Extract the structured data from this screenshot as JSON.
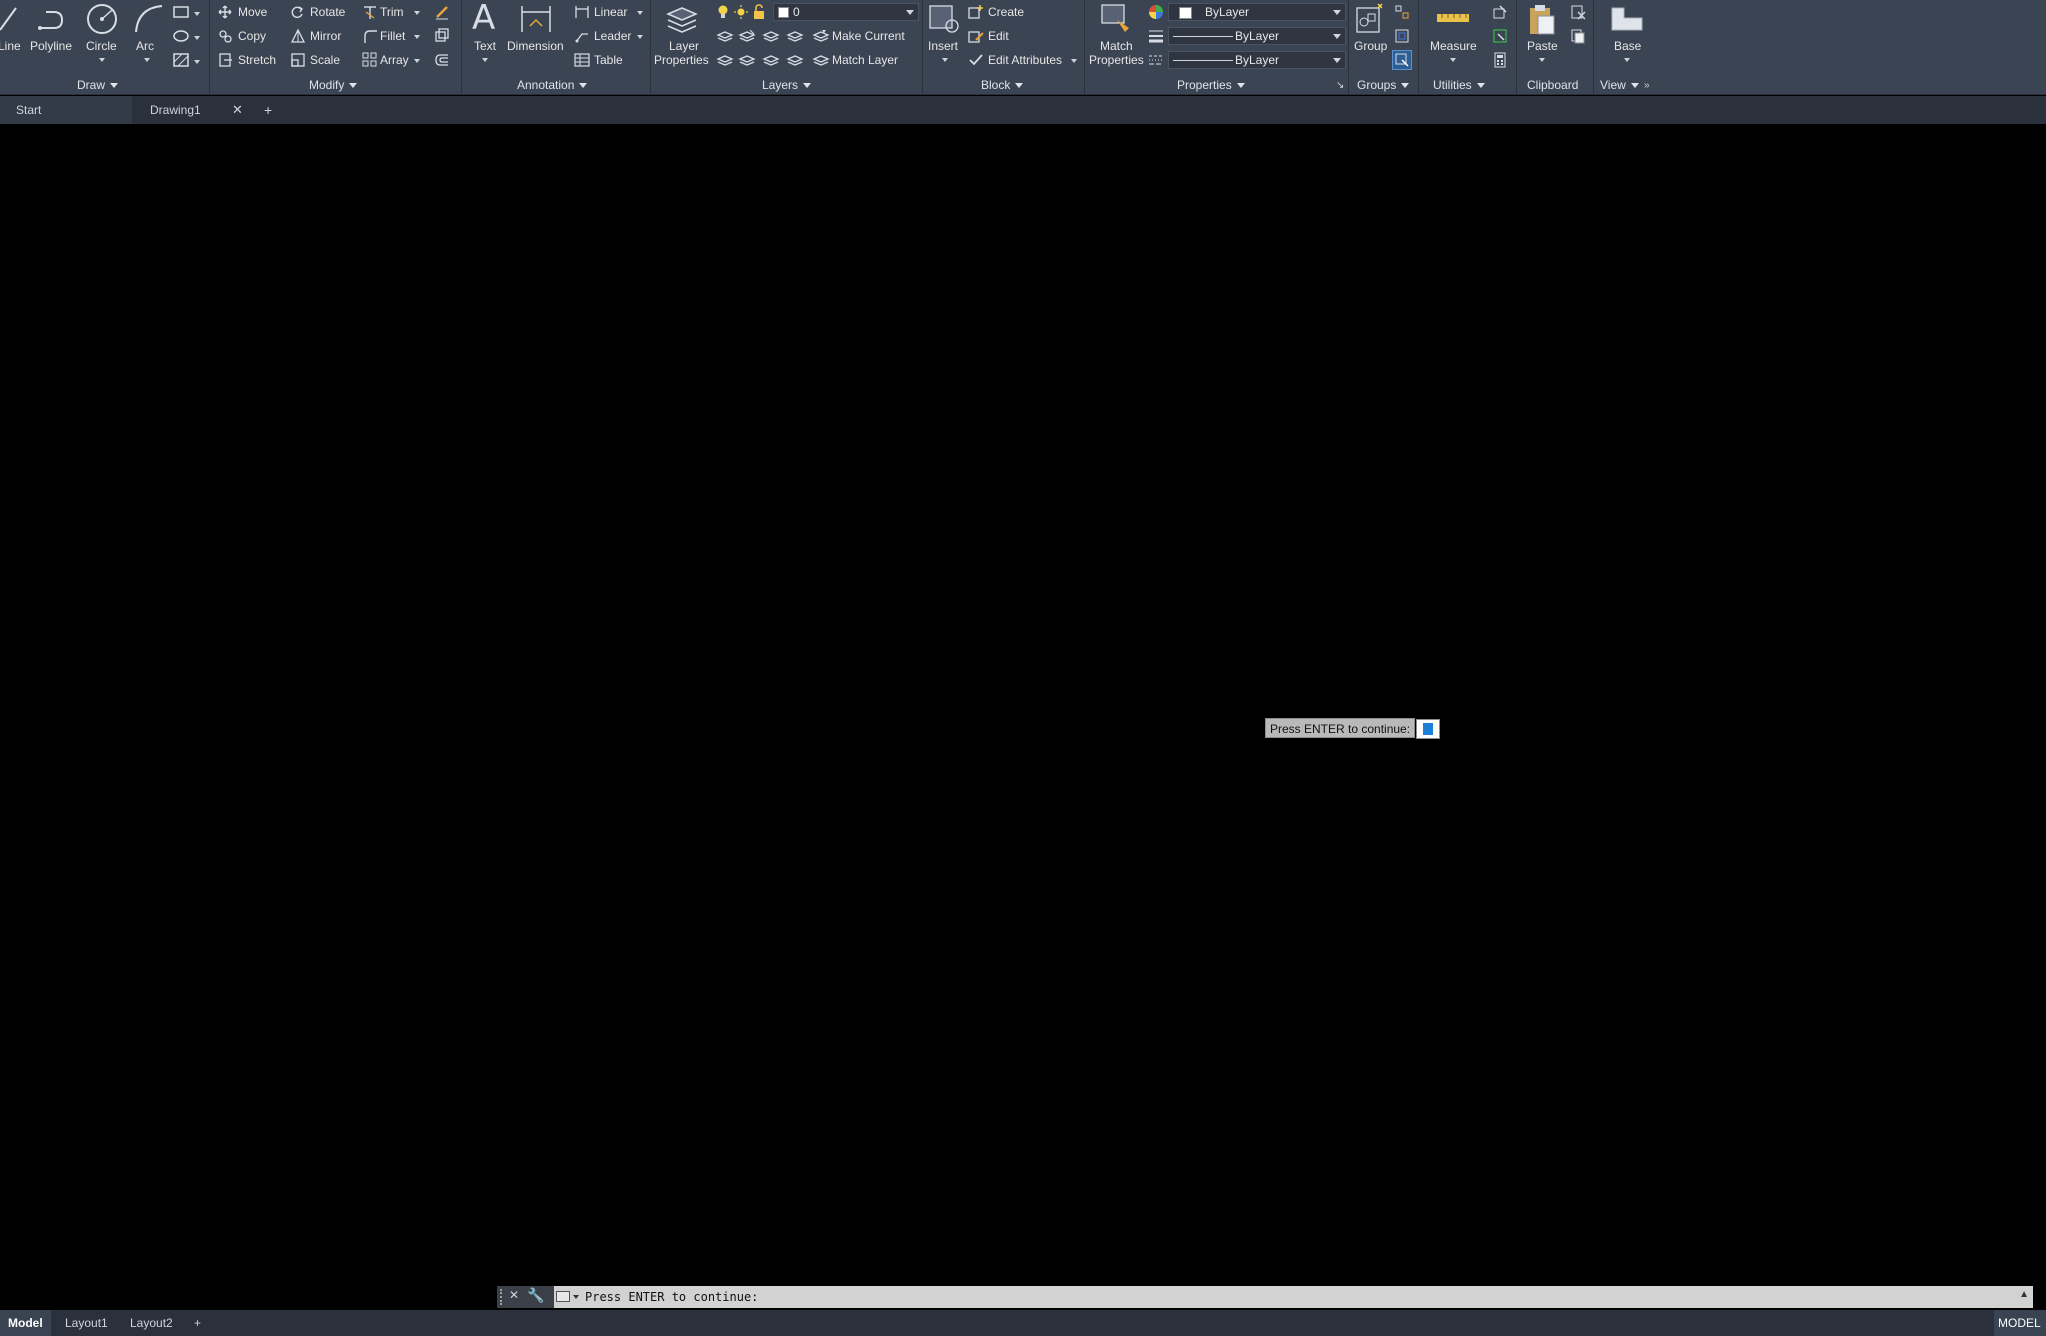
{
  "ribbon": {
    "draw": {
      "line": "Line",
      "polyline": "Polyline",
      "circle": "Circle",
      "arc": "Arc",
      "panel_title": "Draw"
    },
    "modify": {
      "move": "Move",
      "rotate": "Rotate",
      "trim": "Trim",
      "copy": "Copy",
      "mirror": "Mirror",
      "fillet": "Fillet",
      "stretch": "Stretch",
      "scale": "Scale",
      "array": "Array",
      "panel_title": "Modify"
    },
    "annotation": {
      "text": "Text",
      "dimension": "Dimension",
      "linear": "Linear",
      "leader": "Leader",
      "table": "Table",
      "panel_title": "Annotation"
    },
    "layers": {
      "layer_properties": "Layer Properties",
      "layer_properties_line1": "Layer",
      "layer_properties_line2": "Properties",
      "current_layer": "0",
      "make_current": "Make Current",
      "match_layer": "Match Layer",
      "panel_title": "Layers"
    },
    "block": {
      "insert": "Insert",
      "create": "Create",
      "edit": "Edit",
      "edit_attributes": "Edit Attributes",
      "panel_title": "Block"
    },
    "properties": {
      "match_properties_line1": "Match",
      "match_properties_line2": "Properties",
      "color": "ByLayer",
      "lineweight": "ByLayer",
      "linetype": "ByLayer",
      "panel_title": "Properties"
    },
    "groups": {
      "group": "Group",
      "panel_title": "Groups"
    },
    "utilities": {
      "measure": "Measure",
      "panel_title": "Utilities"
    },
    "clipboard": {
      "paste": "Paste",
      "panel_title": "Clipboard"
    },
    "view": {
      "base": "Base",
      "panel_title": "View"
    }
  },
  "file_tabs": {
    "start": "Start",
    "drawing1": "Drawing1",
    "new_tab": "+"
  },
  "prompt": {
    "tooltip": "Press ENTER to continue:"
  },
  "command_line": {
    "text": "Press ENTER to continue:"
  },
  "layout_tabs": {
    "model": "Model",
    "layout1": "Layout1",
    "layout2": "Layout2",
    "add": "+"
  },
  "status": {
    "mode": "MODEL"
  },
  "colors": {
    "ribbon_bg": "#3b4453",
    "canvas_bg": "#000000",
    "accent_blue": "#1e7fd6",
    "pencil_orange": "#e8a33a"
  }
}
